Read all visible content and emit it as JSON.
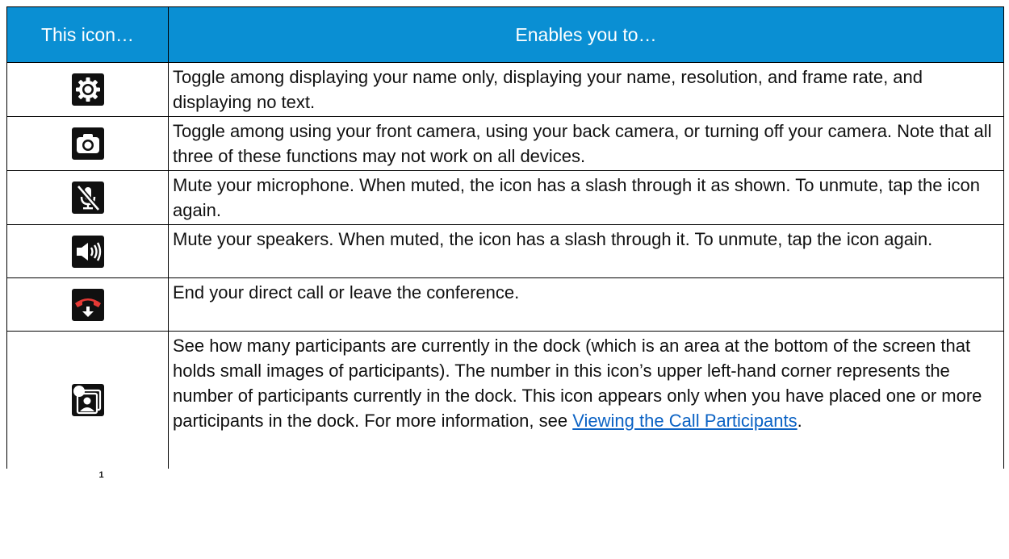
{
  "table": {
    "headers": {
      "icon": "This icon…",
      "description": "Enables you to…"
    },
    "rows": [
      {
        "icon": "gear-icon",
        "text": "Toggle among displaying your name only, displaying your name, resolution, and frame rate, and displaying no text."
      },
      {
        "icon": "camera-icon",
        "text": "Toggle among using your front camera, using your back camera, or turning off your camera. Note that all three of these functions may not work on all devices."
      },
      {
        "icon": "muted-microphone-icon",
        "text": "Mute your microphone. When muted, the icon has a slash through it as shown. To unmute, tap the icon again."
      },
      {
        "icon": "speaker-icon",
        "text": "Mute your speakers. When muted, the icon has a slash through it. To unmute, tap the icon again."
      },
      {
        "icon": "end-call-icon",
        "text": "End your direct call or leave the conference."
      },
      {
        "icon": "dock-participants-icon",
        "badge": "1",
        "text": "See how many participants are currently in the dock (which is an area at the bottom of the screen that holds small images of participants). The number in this icon’s upper left-hand corner represents the number of participants currently in the dock. This icon appears only when you have placed one or more participants in the dock. For more information, see ",
        "link": "Viewing the Call Participants",
        "suffix": "."
      }
    ]
  },
  "colors": {
    "header_background": "#0a8fd3",
    "icon_background": "#101010",
    "end_call_red": "#e53935",
    "link": "#0b62c4"
  }
}
